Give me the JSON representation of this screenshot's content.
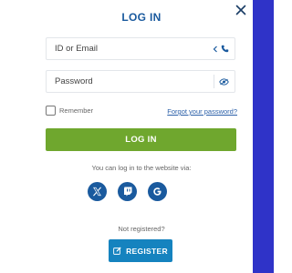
{
  "modal": {
    "title": "LOG IN",
    "close_icon": "close-icon"
  },
  "form": {
    "email_placeholder": "ID or Email",
    "password_placeholder": "Password",
    "email_addon_icons": [
      "chevron-left-icon",
      "phone-icon"
    ],
    "password_addon_icon": "eye-icon",
    "remember_label": "Remember",
    "forgot_label": "Forgot your password?",
    "login_label": "LOG IN"
  },
  "social": {
    "caption": "You can log in to the website via:",
    "providers": [
      "x-icon",
      "twitch-icon",
      "google-icon"
    ]
  },
  "register": {
    "caption": "Not registered?",
    "label": "REGISTER",
    "icon": "edit-icon"
  },
  "colors": {
    "title": "#1a5a9e",
    "login_button": "#6fa72e",
    "register_button": "#1583bf",
    "social_circle": "#1a5a9e",
    "right_edge": "#2f33c8"
  }
}
